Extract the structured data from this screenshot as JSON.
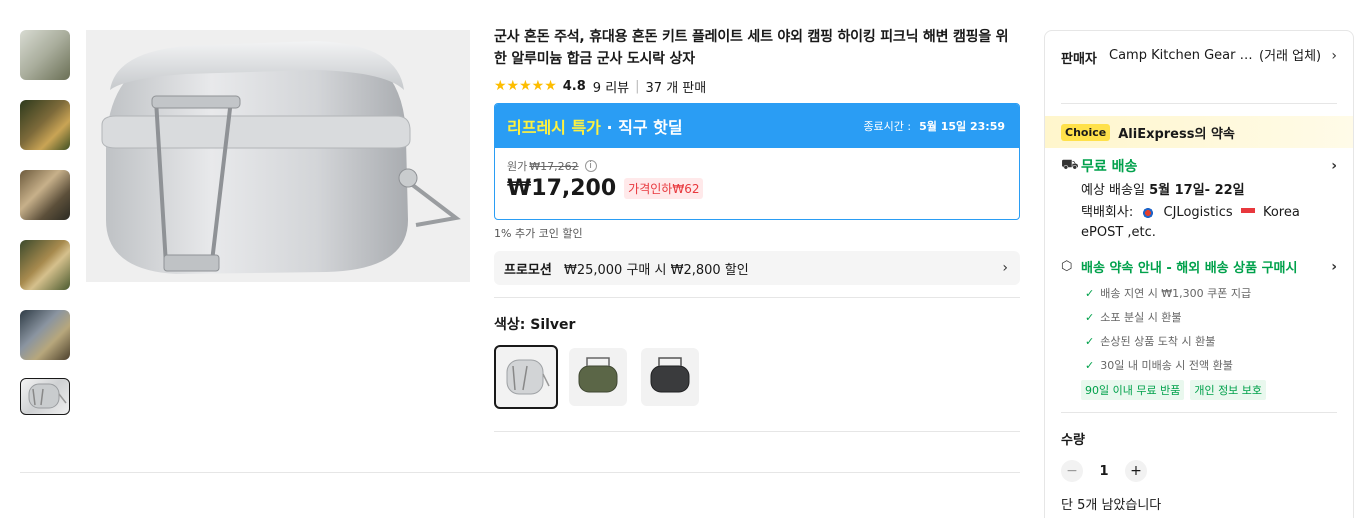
{
  "product": {
    "title": "군사 혼돈 주석, 휴대용 혼돈 키트 플레이트 세트 야외 캠핑 하이킹 피크닉 해변 캠핑을 위한 알루미늄 합금 군사 도시락 상자",
    "stars": "★★★★★",
    "rating": "4.8",
    "reviews": "9 리뷰",
    "sold": "37 개 판매"
  },
  "deal": {
    "label_highlight": "리프레시 특가",
    "label_rest": " · 직구 핫딜",
    "end_label": "종료시간 :",
    "end_time": "5월 15일 23:59",
    "original_label": "원가",
    "original_price": "₩17,262",
    "info_icon": "ⓘ",
    "price": "₩17,200",
    "discount": "가격인하₩62"
  },
  "coin_note": "1% 추가 코인 할인",
  "promotion": {
    "label": "프로모션",
    "text": "₩25,000 구매 시 ₩2,800 할인"
  },
  "color": {
    "label": "색상: Silver",
    "options": [
      "silver-mess-kit",
      "green-mess-kit",
      "black-mess-kit"
    ]
  },
  "seller": {
    "label": "판매자",
    "name": "Camp Kitchen Gear St...",
    "type": "(거래 업체)"
  },
  "choice": {
    "badge": "Choice",
    "text": "AliExpress의 약속"
  },
  "shipping": {
    "title": "무료 배송",
    "eta_prefix": "예상 배송일",
    "eta": "5월 17일- 22일",
    "carrier_prefix": "택배회사:",
    "carrier1": "CJLogistics",
    "carrier2": "Korea",
    "carrier3": "ePOST ,etc."
  },
  "promise": {
    "title": "배송 약속 안내 - 해외 배송 상품 구매시",
    "items": [
      "배송 지연 시 ₩1,300 쿠폰 지급",
      "소포 분실 시 환불",
      "손상된 상품 도착 시 환불",
      "30일 내 미배송 시 전액 환불"
    ],
    "tags": [
      "90일 이내 무료 반품",
      "개인 정보 보호"
    ]
  },
  "quantity": {
    "label": "수량",
    "value": "1",
    "minus": "−",
    "plus": "+",
    "stock": "단 5개 남았습니다"
  },
  "colors": {
    "accent_blue": "#2a9df4",
    "price_red": "#e8383d",
    "green": "#00a14b",
    "star": "#fdbd00"
  }
}
